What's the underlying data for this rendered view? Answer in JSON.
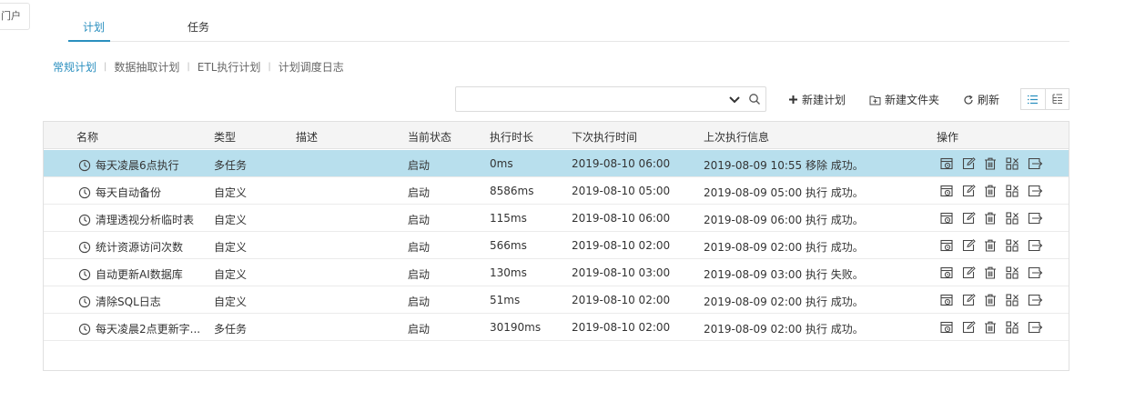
{
  "portal_tab": {
    "label": "门户"
  },
  "main_tabs": [
    {
      "label": "计划",
      "active": true
    },
    {
      "label": "任务",
      "active": false
    }
  ],
  "subnav": [
    {
      "label": "常规计划",
      "active": true
    },
    {
      "label": "数据抽取计划",
      "active": false
    },
    {
      "label": "ETL执行计划",
      "active": false
    },
    {
      "label": "计划调度日志",
      "active": false
    }
  ],
  "search": {
    "value": "",
    "placeholder": ""
  },
  "toolbar": {
    "new_plan": "新建计划",
    "new_folder": "新建文件夹",
    "refresh": "刷新"
  },
  "table": {
    "columns": [
      "名称",
      "类型",
      "描述",
      "当前状态",
      "执行时长",
      "下次执行时间",
      "上次执行信息",
      "操作"
    ],
    "rows": [
      {
        "name": "每天凌晨6点执行",
        "type": "多任务",
        "desc": "",
        "status": "启动",
        "duration": "0ms",
        "next": "2019-08-10 06:00",
        "last": "2019-08-09 10:55 移除 成功。",
        "selected": true
      },
      {
        "name": "每天自动备份",
        "type": "自定义",
        "desc": "",
        "status": "启动",
        "duration": "8586ms",
        "next": "2019-08-10 05:00",
        "last": "2019-08-09 05:00 执行 成功。",
        "selected": false
      },
      {
        "name": "清理透视分析临时表",
        "type": "自定义",
        "desc": "",
        "status": "启动",
        "duration": "115ms",
        "next": "2019-08-10 06:00",
        "last": "2019-08-09 06:00 执行 成功。",
        "selected": false
      },
      {
        "name": "统计资源访问次数",
        "type": "自定义",
        "desc": "",
        "status": "启动",
        "duration": "566ms",
        "next": "2019-08-10 02:00",
        "last": "2019-08-09 02:00 执行 成功。",
        "selected": false
      },
      {
        "name": "自动更新AI数据库",
        "type": "自定义",
        "desc": "",
        "status": "启动",
        "duration": "130ms",
        "next": "2019-08-10 03:00",
        "last": "2019-08-09 03:00 执行 失败。",
        "selected": false
      },
      {
        "name": "清除SQL日志",
        "type": "自定义",
        "desc": "",
        "status": "启动",
        "duration": "51ms",
        "next": "2019-08-10 02:00",
        "last": "2019-08-09 02:00 执行 成功。",
        "selected": false
      },
      {
        "name": "每天凌晨2点更新字...",
        "type": "多任务",
        "desc": "",
        "status": "启动",
        "duration": "30190ms",
        "next": "2019-08-10 02:00",
        "last": "2019-08-09 02:00 执行 成功。",
        "selected": false
      }
    ],
    "row_icon": "clock-icon",
    "op_icons": [
      "run-now-icon",
      "edit-icon",
      "delete-icon",
      "permissions-icon",
      "move-icon"
    ]
  },
  "colors": {
    "accent": "#2a8fbf",
    "selected_row": "#b8dfed",
    "header_bg": "#f4f4f4"
  }
}
